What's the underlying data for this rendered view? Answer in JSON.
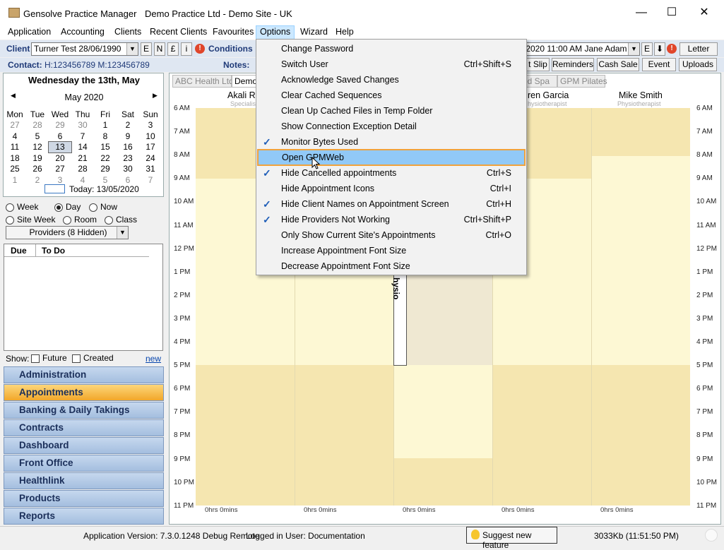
{
  "window": {
    "app_name": "Gensolve Practice Manager",
    "title": "Demo Practice Ltd - Demo Site - UK",
    "controls": [
      "—",
      "☐",
      "✕"
    ]
  },
  "menubar": [
    "Application",
    "Accounting",
    "Clients",
    "Recent Clients",
    "Favourites",
    "Options",
    "Wizard",
    "Help"
  ],
  "toolbar": {
    "client_label": "Client",
    "client_value": "Turner Test 28/06/1990",
    "client_btns": [
      "E",
      "N",
      "£",
      "i"
    ],
    "conditions_label": "Conditions",
    "appointment_value": "/2020  11:00 AM Jane Adam",
    "appt_btns": [
      "E",
      "⬇"
    ],
    "letter_button": "Letter",
    "contact_label": "Contact:",
    "contact_value": "H:123456789  M:123456789",
    "notes_label": "Notes:",
    "buttons2": [
      "t Slip",
      "Reminders",
      "Cash Sale",
      "Event",
      "Uploads"
    ]
  },
  "calendar": {
    "header": "Wednesday the 13th, May",
    "month": "May 2020",
    "prev": "◀",
    "next": "▶",
    "weekdays": [
      "Mon",
      "Tue",
      "Wed",
      "Thu",
      "Fri",
      "Sat",
      "Sun"
    ],
    "weeks": [
      [
        "27",
        "28",
        "29",
        "30",
        "1",
        "2",
        "3"
      ],
      [
        "4",
        "5",
        "6",
        "7",
        "8",
        "9",
        "10"
      ],
      [
        "11",
        "12",
        "13",
        "14",
        "15",
        "16",
        "17"
      ],
      [
        "18",
        "19",
        "20",
        "21",
        "22",
        "23",
        "24"
      ],
      [
        "25",
        "26",
        "27",
        "28",
        "29",
        "30",
        "31"
      ],
      [
        "1",
        "2",
        "3",
        "4",
        "5",
        "6",
        "7"
      ]
    ],
    "selected": "13",
    "today_label": "Today: 13/05/2020"
  },
  "view_options": {
    "row1": [
      "Week",
      "Day",
      "Now"
    ],
    "row2": [
      "Site Week",
      "Room",
      "Class"
    ],
    "selected": "Day",
    "providers_dropdown": "Providers (8 Hidden)"
  },
  "todo": {
    "col_due": "Due",
    "col_todo": "To Do",
    "show_label": "Show:",
    "future_label": "Future",
    "created_label": "Created",
    "new_link": "new"
  },
  "nav": [
    {
      "label": "Administration",
      "active": false
    },
    {
      "label": "Appointments",
      "active": true
    },
    {
      "label": "Banking & Daily Takings",
      "active": false
    },
    {
      "label": "Contracts",
      "active": false
    },
    {
      "label": "Dashboard",
      "active": false
    },
    {
      "label": "Front Office",
      "active": false
    },
    {
      "label": "Healthlink",
      "active": false
    },
    {
      "label": "Products",
      "active": false
    },
    {
      "label": "Reports",
      "active": false
    }
  ],
  "schedule": {
    "tabs": [
      "ABC Health Ltd.",
      "Demo",
      "zed Spa",
      "GPM Pilates"
    ],
    "providers": [
      {
        "name": "Akali R",
        "role": "Specialis"
      },
      {
        "name": "ren Garcia",
        "role": "hysiotherapist"
      },
      {
        "name": "Mike Smith",
        "role": "Physiotherapist"
      }
    ],
    "times": [
      "6 AM",
      "7 AM",
      "8 AM",
      "9 AM",
      "10 AM",
      "11 AM",
      "12 PM",
      "1 PM",
      "2 PM",
      "3 PM",
      "4 PM",
      "5 PM",
      "6 PM",
      "7 PM",
      "8 PM",
      "9 PM",
      "10 PM",
      "11 PM"
    ],
    "footer_hours": [
      "0hrs 0mins",
      "0hrs 0mins",
      "0hrs 0mins",
      "0hrs 0mins",
      "0hrs 0mins"
    ],
    "appointment_text": "hysio"
  },
  "options_menu": [
    {
      "label": "Change Password",
      "shortcut": "",
      "checked": false
    },
    {
      "label": "Switch User",
      "shortcut": "Ctrl+Shift+S",
      "checked": false
    },
    {
      "label": "Acknowledge Saved Changes",
      "shortcut": "",
      "checked": false
    },
    {
      "label": "Clear Cached Sequences",
      "shortcut": "",
      "checked": false
    },
    {
      "label": "Clean Up Cached Files in Temp Folder",
      "shortcut": "",
      "checked": false
    },
    {
      "label": "Show Connection Exception Detail",
      "shortcut": "",
      "checked": false
    },
    {
      "label": "Monitor Bytes Used",
      "shortcut": "",
      "checked": true
    },
    {
      "label": "Open GPMWeb",
      "shortcut": "",
      "checked": false,
      "highlighted": true
    },
    {
      "label": "Hide Cancelled appointments",
      "shortcut": "Ctrl+S",
      "checked": true
    },
    {
      "label": "Hide Appointment Icons",
      "shortcut": "Ctrl+I",
      "checked": false
    },
    {
      "label": "Hide Client Names on Appointment Screen",
      "shortcut": "Ctrl+H",
      "checked": true
    },
    {
      "label": "Hide Providers Not Working",
      "shortcut": "Ctrl+Shift+P",
      "checked": true
    },
    {
      "label": "Only Show Current Site's Appointments",
      "shortcut": "Ctrl+O",
      "checked": false
    },
    {
      "label": "Increase Appointment Font Size",
      "shortcut": "",
      "checked": false
    },
    {
      "label": "Decrease Appointment Font Size",
      "shortcut": "",
      "checked": false
    }
  ],
  "statusbar": {
    "version": "Application Version: 7.3.0.1248 Debug Remote",
    "user": "Logged in User: Documentation",
    "suggest": "Suggest new feature",
    "memory": "3033Kb  (11:51:50 PM)"
  },
  "colors": {
    "accent_orange": "#f2a72a",
    "nav_blue": "#a4bedf",
    "menu_highlight": "#91c9f7",
    "offhours": "#f5e6b0",
    "workhours": "#fdf8d4"
  }
}
